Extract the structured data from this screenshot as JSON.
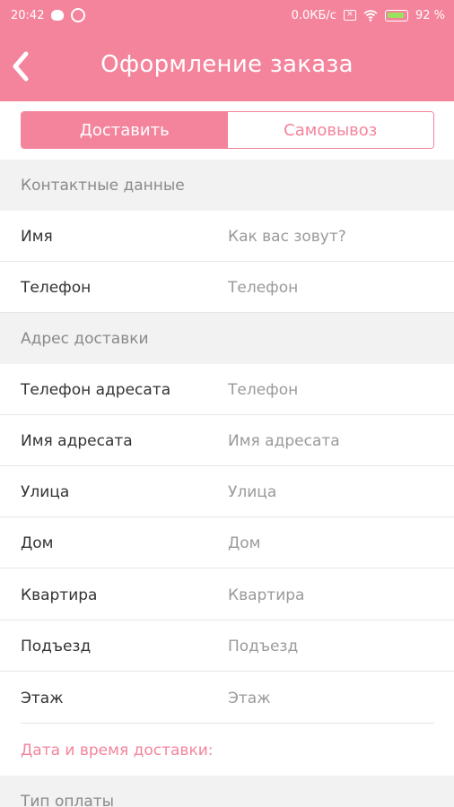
{
  "status_bar": {
    "time": "20:42",
    "network_speed": "0.0КБ/с",
    "battery": "92 %"
  },
  "header": {
    "title": "Оформление заказа"
  },
  "delivery_toggle": {
    "deliver_label": "Доставить",
    "pickup_label": "Самовывоз"
  },
  "contacts": {
    "section_title": "Контактные данные",
    "name_label": "Имя",
    "name_placeholder": "Как вас зовут?",
    "phone_label": "Телефон",
    "phone_placeholder": "Телефон"
  },
  "address": {
    "section_title": "Адрес доставки",
    "recipient_phone_label": "Телефон адресата",
    "recipient_phone_placeholder": "Телефон",
    "recipient_name_label": "Имя адресата",
    "recipient_name_placeholder": "Имя адресата",
    "street_label": "Улица",
    "street_placeholder": "Улица",
    "house_label": "Дом",
    "house_placeholder": "Дом",
    "apartment_label": "Квартира",
    "apartment_placeholder": "Квартира",
    "entrance_label": "Подъезд",
    "entrance_placeholder": "Подъезд",
    "floor_label": "Этаж",
    "floor_placeholder": "Этаж"
  },
  "datetime_link": "Дата и время доставки:",
  "payment": {
    "section_title": "Тип оплаты"
  },
  "colors": {
    "accent": "#f4849c",
    "section_bg": "#f2f2f2"
  }
}
